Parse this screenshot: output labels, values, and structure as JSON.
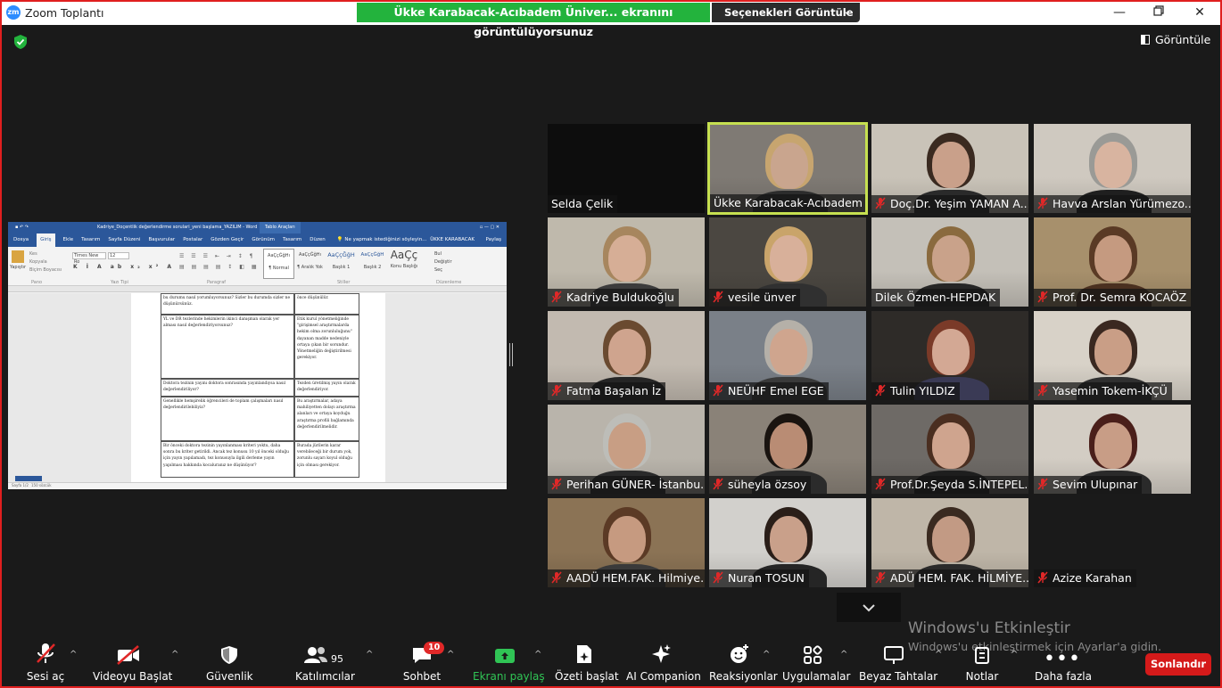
{
  "app": {
    "title": "Zoom Toplantı",
    "logo_text": "zm"
  },
  "banner": {
    "sharing_text": "Ükke Karabacak-Acıbadem Üniver... ekranını görüntülüyorsunuz",
    "view_options_label": "Seçenekleri Görüntüle"
  },
  "view_button": {
    "label": "Görüntüle"
  },
  "shared_document": {
    "window_title": "Kadriye_Doçentlik değerlendirme sorulari_yeni başlama_YAZILIM - Word",
    "context_tab": "Tablo Araçları",
    "tabs": [
      "Dosya",
      "Giriş",
      "Ekle",
      "Tasarım",
      "Sayfa Düzeni",
      "Başvurular",
      "Postalar",
      "Gözden Geçir",
      "Görünüm",
      "Tasarım",
      "Düzen"
    ],
    "tell_me": "Ne yapmak istediğinizi söyleyin...",
    "user": "ÜKKE KARABACAK",
    "share": "Paylaş",
    "font_name": "Times New Ro",
    "font_size": "12",
    "clipboard": [
      "Kes",
      "Kopyala",
      "Biçim Boyacısı"
    ],
    "paste": "Yapıştır",
    "styles": [
      {
        "sample": "AaÇçĞğHı",
        "name": "¶ Normal"
      },
      {
        "sample": "AaÇçĞğHı",
        "name": "¶ Aralık Yok"
      },
      {
        "sample": "AaÇçĞğH",
        "name": "Başlık 1"
      },
      {
        "sample": "AaÇçĞğH",
        "name": "Başlık 2"
      },
      {
        "sample": "AaÇç",
        "name": "Konu Başlığı"
      }
    ],
    "editing": [
      "Bul",
      "Değiştir",
      "Seç"
    ],
    "groups": [
      "Pano",
      "Yazı Tipi",
      "Paragraf",
      "Stiller",
      "Düzenleme"
    ],
    "rows": [
      {
        "left": "bu durumu nasıl yorumluyorsunuz? Sizler bu durumda sizler ne düşünürsünüz.",
        "right": "önce düşünülür."
      },
      {
        "left": "YL ve DR tezlerinde hekimlerin ikinci danışman olarak yer alması nasıl değerlendiriyorsunuz?",
        "right": "Etik kurul yönetmeliğinde \"girişimsel araştırmalarda hekim olma zorunluluğunu\" dayanan madde nedeniyle ortaya çıkan bir sorundur. Yönetmeliğin değiştirilmesi gerekiyor."
      },
      {
        "left": "Doktora tezinin yayını doktora sonrasında yayınlandıysa nasıl değerlendiriliyor?",
        "right": "Tezden üretilmiş yayın olarak değerlendiriyor."
      },
      {
        "left": "Genellikle hemşirelik öğrencileri de toplam çalışmaları nasıl değerlendirilebiliyiz?",
        "right": "Bu araştırmalar, adaya mahiliyetten dolayı araştırma alanları ve ortaya koyduğu araştırma profili bağlamında değerlendirilmelidir."
      },
      {
        "left": "Bir önceki doktora tezinin yayınlanması kriteri yoktu, daha sonra bu kriter getirildi. Ancak tez konusu 10 yıl önceki olduğu için yayın yapılamadı, tez konusuyla ilgili derleme yayın yapılması hakkında kocaluranız ne düşünüyor?",
        "right": "Burada jürilerin karar verebileceği bir durum yok, zorunlu sayarı koyul olduğu için olması gerekiyor."
      }
    ],
    "status": [
      "Sayfa 1/2",
      "150 sözcük"
    ]
  },
  "participants": [
    {
      "name": "Selda Çelik",
      "muted": false,
      "video": false,
      "active": false
    },
    {
      "name": "Ükke Karabacak-Acıbadem ...",
      "muted": false,
      "video": true,
      "active": true
    },
    {
      "name": "Doç.Dr. Yeşim YAMAN A...",
      "muted": true,
      "video": true,
      "active": false
    },
    {
      "name": "Havva Arslan Yürümezo...",
      "muted": true,
      "video": true,
      "active": false
    },
    {
      "name": "Kadriye Buldukoğlu",
      "muted": true,
      "video": true,
      "active": false
    },
    {
      "name": "vesile ünver",
      "muted": true,
      "video": true,
      "active": false
    },
    {
      "name": "Dilek Özmen-HEPDAK",
      "muted": false,
      "video": true,
      "active": false
    },
    {
      "name": "Prof. Dr. Semra KOCAÖZ",
      "muted": true,
      "video": true,
      "active": false
    },
    {
      "name": "Fatma Başalan İz",
      "muted": true,
      "video": true,
      "active": false
    },
    {
      "name": "NEÜHF Emel EGE",
      "muted": true,
      "video": true,
      "active": false
    },
    {
      "name": "Tulin YILDIZ",
      "muted": true,
      "video": true,
      "active": false
    },
    {
      "name": "Yasemin Tokem-İKÇÜ",
      "muted": true,
      "video": true,
      "active": false
    },
    {
      "name": "Perihan GÜNER- İstanbu...",
      "muted": true,
      "video": true,
      "active": false
    },
    {
      "name": "süheyla özsoy",
      "muted": true,
      "video": true,
      "active": false
    },
    {
      "name": "Prof.Dr.Şeyda S.İNTEPEL...",
      "muted": true,
      "video": true,
      "active": false
    },
    {
      "name": "Sevim Ulupınar",
      "muted": true,
      "video": true,
      "active": false
    },
    {
      "name": "AADÜ HEM.FAK. Hilmiye...",
      "muted": true,
      "video": true,
      "active": false
    },
    {
      "name": "Nuran TOSUN",
      "muted": true,
      "video": true,
      "active": false
    },
    {
      "name": "ADÜ HEM. FAK. HİLMİYE...",
      "muted": true,
      "video": true,
      "active": false
    },
    {
      "name": "Azize Karahan",
      "muted": true,
      "video": false,
      "active": false
    }
  ],
  "watermark": {
    "title": "Windows'u Etkinleştir",
    "subtitle": "Windows'u etkinleştirmek için Ayarlar'a gidin."
  },
  "toolbar": {
    "audio": "Sesi aç",
    "video": "Videoyu Başlat",
    "security": "Güvenlik",
    "participants": "Katılımcılar",
    "participants_count": "95",
    "chat": "Sohbet",
    "chat_badge": "10",
    "share": "Ekranı paylaş",
    "summary": "Özeti başlat",
    "ai": "AI Companion",
    "reactions": "Reaksiyonlar",
    "apps": "Uygulamalar",
    "whiteboard": "Beyaz Tahtalar",
    "notes": "Notlar",
    "more": "Daha fazla",
    "end": "Sonlandır"
  },
  "colors": {
    "share_green": "#23b33d",
    "active_speaker": "#c6e050",
    "end_red": "#d51a1a",
    "window_border": "#e01f1f"
  }
}
